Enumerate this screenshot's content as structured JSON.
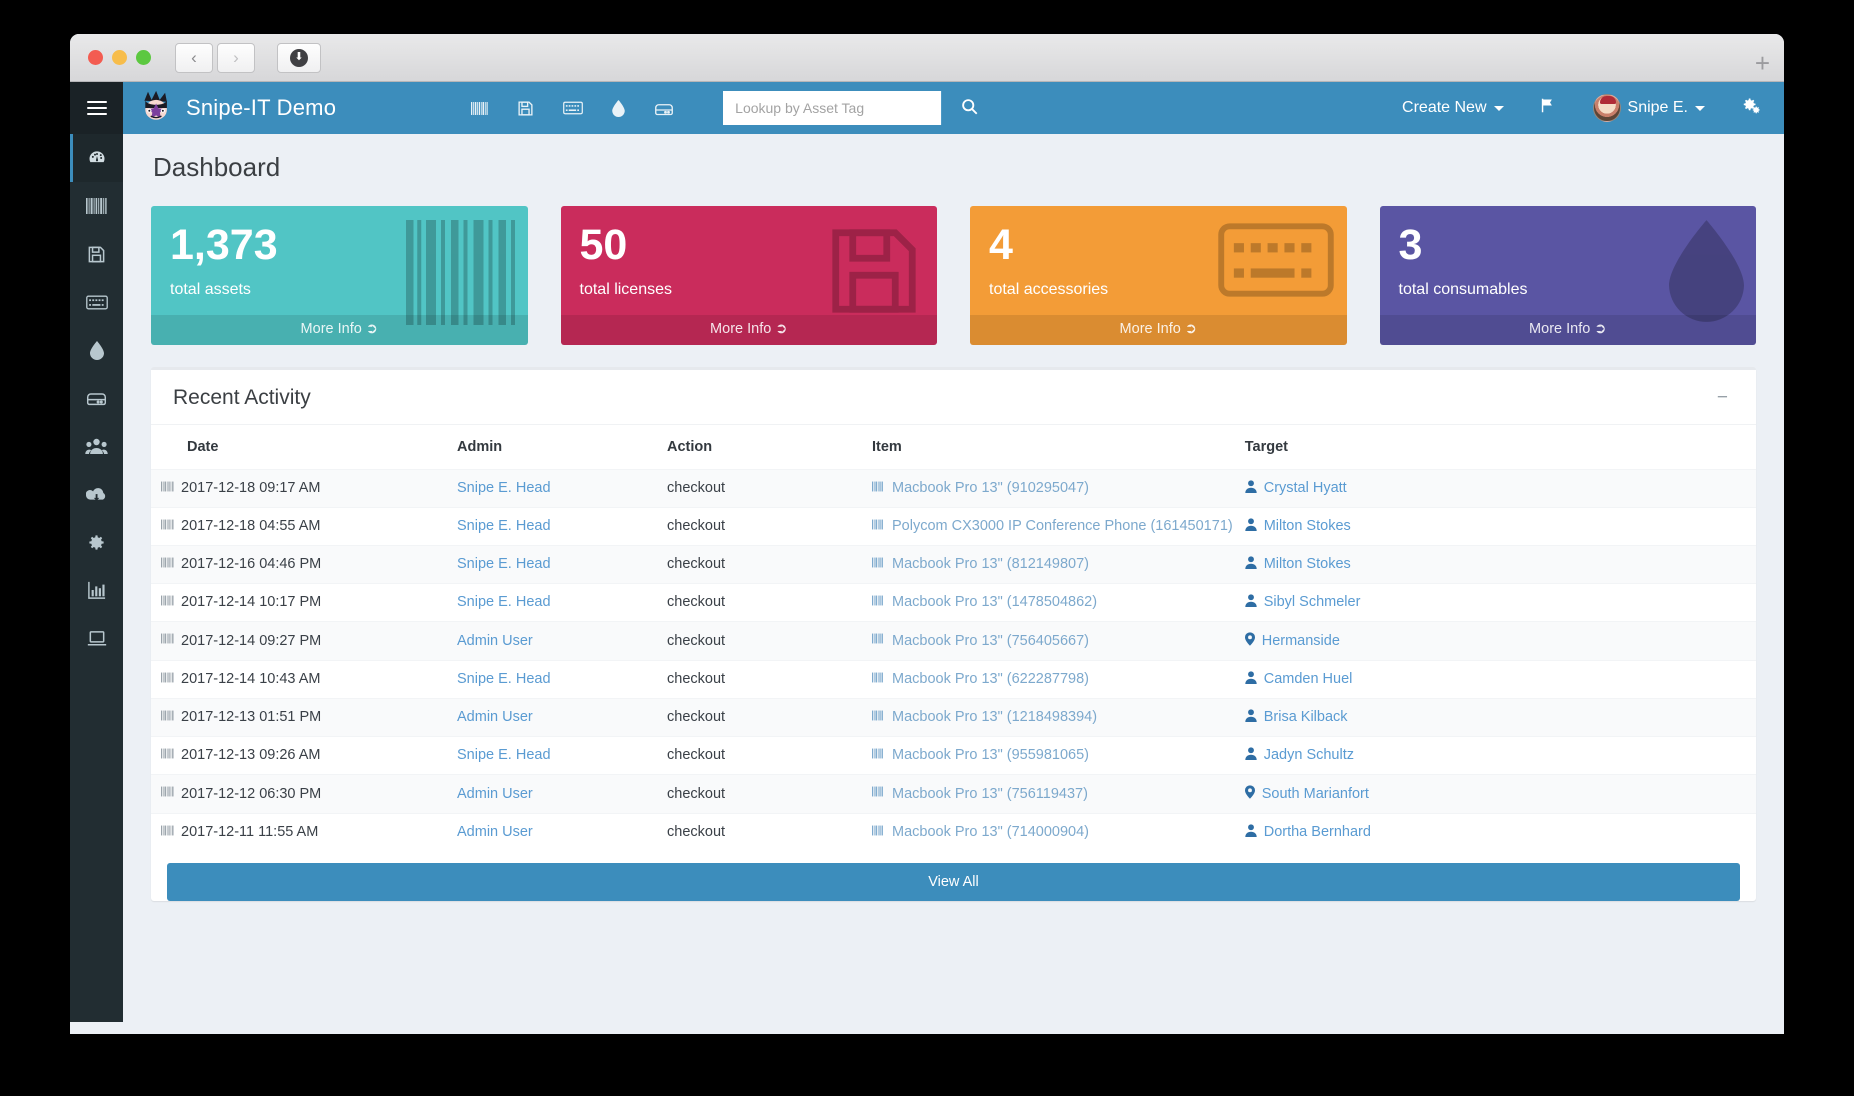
{
  "browser": {
    "back_icon": "chevron-left-icon",
    "forward_icon": "chevron-right-icon",
    "download_icon": "download-icon",
    "new_tab_label": "+"
  },
  "navbar": {
    "brand": "Snipe-IT Demo",
    "icons": [
      "barcode-icon",
      "floppy-disk-icon",
      "keyboard-icon",
      "droplet-icon",
      "component-icon"
    ],
    "search": {
      "placeholder": "Lookup by Asset Tag",
      "value": "",
      "button_icon": "search-icon"
    },
    "create_new": "Create New",
    "flag_icon": "flag-icon",
    "user": "Snipe E.",
    "settings_icon": "gears-icon",
    "bg_color": "#3c8dbc"
  },
  "sidebar": {
    "toggle_icon": "hamburger-icon",
    "items": [
      {
        "icon": "dashboard-icon",
        "active": true
      },
      {
        "icon": "barcode-icon",
        "active": false
      },
      {
        "icon": "floppy-disk-icon",
        "active": false
      },
      {
        "icon": "keyboard-icon",
        "active": false
      },
      {
        "icon": "droplet-icon",
        "active": false
      },
      {
        "icon": "component-icon",
        "active": false
      },
      {
        "icon": "users-icon",
        "active": false
      },
      {
        "icon": "cloud-download-icon",
        "active": false
      },
      {
        "icon": "gear-icon",
        "active": false
      },
      {
        "icon": "bar-chart-icon",
        "active": false
      },
      {
        "icon": "laptop-icon",
        "active": false
      }
    ]
  },
  "page": {
    "title": "Dashboard"
  },
  "cards": [
    {
      "value": "1,373",
      "label": "total assets",
      "more": "More Info",
      "color": "#51c5c5",
      "watermark": "barcode-icon"
    },
    {
      "value": "50",
      "label": "total licenses",
      "more": "More Info",
      "color": "#ca2c5c",
      "watermark": "floppy-disk-icon"
    },
    {
      "value": "4",
      "label": "total accessories",
      "more": "More Info",
      "color": "#f39c37",
      "watermark": "keyboard-icon"
    },
    {
      "value": "3",
      "label": "total consumables",
      "more": "More Info",
      "color": "#5a55a3",
      "watermark": "droplet-icon"
    }
  ],
  "activity": {
    "title": "Recent Activity",
    "collapse_icon": "minus-icon",
    "columns": [
      "Date",
      "Admin",
      "Action",
      "Item",
      "Target"
    ],
    "rows": [
      {
        "date": "2017-12-18 09:17 AM",
        "admin": "Snipe E. Head",
        "action": "checkout",
        "item": "Macbook Pro 13\" (910295047)",
        "target": "Crystal Hyatt",
        "target_icon": "user-icon"
      },
      {
        "date": "2017-12-18 04:55 AM",
        "admin": "Snipe E. Head",
        "action": "checkout",
        "item": "Polycom CX3000 IP Conference Phone (161450171)",
        "target": "Milton Stokes",
        "target_icon": "user-icon"
      },
      {
        "date": "2017-12-16 04:46 PM",
        "admin": "Snipe E. Head",
        "action": "checkout",
        "item": "Macbook Pro 13\" (812149807)",
        "target": "Milton Stokes",
        "target_icon": "user-icon"
      },
      {
        "date": "2017-12-14 10:17 PM",
        "admin": "Snipe E. Head",
        "action": "checkout",
        "item": "Macbook Pro 13\" (1478504862)",
        "target": "Sibyl Schmeler",
        "target_icon": "user-icon"
      },
      {
        "date": "2017-12-14 09:27 PM",
        "admin": "Admin User",
        "action": "checkout",
        "item": "Macbook Pro 13\" (756405667)",
        "target": "Hermanside",
        "target_icon": "map-marker-icon"
      },
      {
        "date": "2017-12-14 10:43 AM",
        "admin": "Snipe E. Head",
        "action": "checkout",
        "item": "Macbook Pro 13\" (622287798)",
        "target": "Camden Huel",
        "target_icon": "user-icon"
      },
      {
        "date": "2017-12-13 01:51 PM",
        "admin": "Admin User",
        "action": "checkout",
        "item": "Macbook Pro 13\" (1218498394)",
        "target": "Brisa Kilback",
        "target_icon": "user-icon"
      },
      {
        "date": "2017-12-13 09:26 AM",
        "admin": "Snipe E. Head",
        "action": "checkout",
        "item": "Macbook Pro 13\" (955981065)",
        "target": "Jadyn Schultz",
        "target_icon": "user-icon"
      },
      {
        "date": "2017-12-12 06:30 PM",
        "admin": "Admin User",
        "action": "checkout",
        "item": "Macbook Pro 13\" (756119437)",
        "target": "South Marianfort",
        "target_icon": "map-marker-icon"
      },
      {
        "date": "2017-12-11 11:55 AM",
        "admin": "Admin User",
        "action": "checkout",
        "item": "Macbook Pro 13\" (714000904)",
        "target": "Dortha Bernhard",
        "target_icon": "user-icon"
      }
    ],
    "view_all": "View All"
  }
}
